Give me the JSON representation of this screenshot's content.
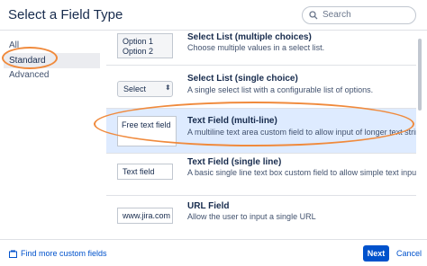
{
  "dialog": {
    "title": "Select a Field Type"
  },
  "search": {
    "placeholder": "Search"
  },
  "sidebar": {
    "items": [
      {
        "label": "All"
      },
      {
        "label": "Standard"
      },
      {
        "label": "Advanced"
      }
    ]
  },
  "fields": [
    {
      "title": "Select List (multiple choices)",
      "description": "Choose multiple values in a select list.",
      "preview": [
        "Option 1",
        "Option 2"
      ]
    },
    {
      "title": "Select List (single choice)",
      "description": "A single select list with a configurable list of options.",
      "preview": "Select"
    },
    {
      "title": "Text Field (multi-line)",
      "description": "A multiline text area custom field to allow input of longer text strings.",
      "preview": "Free text field"
    },
    {
      "title": "Text Field (single line)",
      "description": "A basic single line text box custom field to allow simple text input.",
      "preview": "Text field"
    },
    {
      "title": "URL Field",
      "description": "Allow the user to input a single URL",
      "preview": "www.jira.com"
    }
  ],
  "footer": {
    "find_more": "Find more custom fields",
    "next": "Next",
    "cancel": "Cancel"
  },
  "colors": {
    "accent": "#0052cc",
    "selected_row": "#deebff",
    "annotation": "#f08a3c"
  }
}
